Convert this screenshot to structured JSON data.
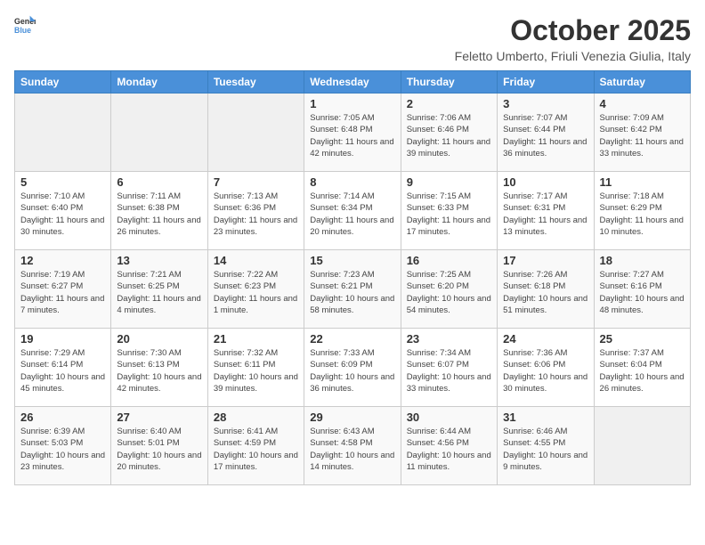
{
  "header": {
    "logo_general": "General",
    "logo_blue": "Blue",
    "title": "October 2025",
    "subtitle": "Feletto Umberto, Friuli Venezia Giulia, Italy"
  },
  "days_of_week": [
    "Sunday",
    "Monday",
    "Tuesday",
    "Wednesday",
    "Thursday",
    "Friday",
    "Saturday"
  ],
  "weeks": [
    [
      {
        "day": "",
        "info": ""
      },
      {
        "day": "",
        "info": ""
      },
      {
        "day": "",
        "info": ""
      },
      {
        "day": "1",
        "info": "Sunrise: 7:05 AM\nSunset: 6:48 PM\nDaylight: 11 hours and 42 minutes."
      },
      {
        "day": "2",
        "info": "Sunrise: 7:06 AM\nSunset: 6:46 PM\nDaylight: 11 hours and 39 minutes."
      },
      {
        "day": "3",
        "info": "Sunrise: 7:07 AM\nSunset: 6:44 PM\nDaylight: 11 hours and 36 minutes."
      },
      {
        "day": "4",
        "info": "Sunrise: 7:09 AM\nSunset: 6:42 PM\nDaylight: 11 hours and 33 minutes."
      }
    ],
    [
      {
        "day": "5",
        "info": "Sunrise: 7:10 AM\nSunset: 6:40 PM\nDaylight: 11 hours and 30 minutes."
      },
      {
        "day": "6",
        "info": "Sunrise: 7:11 AM\nSunset: 6:38 PM\nDaylight: 11 hours and 26 minutes."
      },
      {
        "day": "7",
        "info": "Sunrise: 7:13 AM\nSunset: 6:36 PM\nDaylight: 11 hours and 23 minutes."
      },
      {
        "day": "8",
        "info": "Sunrise: 7:14 AM\nSunset: 6:34 PM\nDaylight: 11 hours and 20 minutes."
      },
      {
        "day": "9",
        "info": "Sunrise: 7:15 AM\nSunset: 6:33 PM\nDaylight: 11 hours and 17 minutes."
      },
      {
        "day": "10",
        "info": "Sunrise: 7:17 AM\nSunset: 6:31 PM\nDaylight: 11 hours and 13 minutes."
      },
      {
        "day": "11",
        "info": "Sunrise: 7:18 AM\nSunset: 6:29 PM\nDaylight: 11 hours and 10 minutes."
      }
    ],
    [
      {
        "day": "12",
        "info": "Sunrise: 7:19 AM\nSunset: 6:27 PM\nDaylight: 11 hours and 7 minutes."
      },
      {
        "day": "13",
        "info": "Sunrise: 7:21 AM\nSunset: 6:25 PM\nDaylight: 11 hours and 4 minutes."
      },
      {
        "day": "14",
        "info": "Sunrise: 7:22 AM\nSunset: 6:23 PM\nDaylight: 11 hours and 1 minute."
      },
      {
        "day": "15",
        "info": "Sunrise: 7:23 AM\nSunset: 6:21 PM\nDaylight: 10 hours and 58 minutes."
      },
      {
        "day": "16",
        "info": "Sunrise: 7:25 AM\nSunset: 6:20 PM\nDaylight: 10 hours and 54 minutes."
      },
      {
        "day": "17",
        "info": "Sunrise: 7:26 AM\nSunset: 6:18 PM\nDaylight: 10 hours and 51 minutes."
      },
      {
        "day": "18",
        "info": "Sunrise: 7:27 AM\nSunset: 6:16 PM\nDaylight: 10 hours and 48 minutes."
      }
    ],
    [
      {
        "day": "19",
        "info": "Sunrise: 7:29 AM\nSunset: 6:14 PM\nDaylight: 10 hours and 45 minutes."
      },
      {
        "day": "20",
        "info": "Sunrise: 7:30 AM\nSunset: 6:13 PM\nDaylight: 10 hours and 42 minutes."
      },
      {
        "day": "21",
        "info": "Sunrise: 7:32 AM\nSunset: 6:11 PM\nDaylight: 10 hours and 39 minutes."
      },
      {
        "day": "22",
        "info": "Sunrise: 7:33 AM\nSunset: 6:09 PM\nDaylight: 10 hours and 36 minutes."
      },
      {
        "day": "23",
        "info": "Sunrise: 7:34 AM\nSunset: 6:07 PM\nDaylight: 10 hours and 33 minutes."
      },
      {
        "day": "24",
        "info": "Sunrise: 7:36 AM\nSunset: 6:06 PM\nDaylight: 10 hours and 30 minutes."
      },
      {
        "day": "25",
        "info": "Sunrise: 7:37 AM\nSunset: 6:04 PM\nDaylight: 10 hours and 26 minutes."
      }
    ],
    [
      {
        "day": "26",
        "info": "Sunrise: 6:39 AM\nSunset: 5:03 PM\nDaylight: 10 hours and 23 minutes."
      },
      {
        "day": "27",
        "info": "Sunrise: 6:40 AM\nSunset: 5:01 PM\nDaylight: 10 hours and 20 minutes."
      },
      {
        "day": "28",
        "info": "Sunrise: 6:41 AM\nSunset: 4:59 PM\nDaylight: 10 hours and 17 minutes."
      },
      {
        "day": "29",
        "info": "Sunrise: 6:43 AM\nSunset: 4:58 PM\nDaylight: 10 hours and 14 minutes."
      },
      {
        "day": "30",
        "info": "Sunrise: 6:44 AM\nSunset: 4:56 PM\nDaylight: 10 hours and 11 minutes."
      },
      {
        "day": "31",
        "info": "Sunrise: 6:46 AM\nSunset: 4:55 PM\nDaylight: 10 hours and 9 minutes."
      },
      {
        "day": "",
        "info": ""
      }
    ]
  ]
}
